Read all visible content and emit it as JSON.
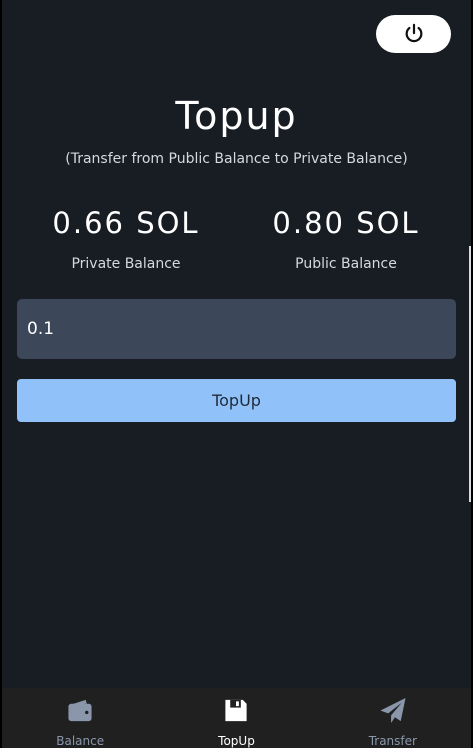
{
  "header": {
    "power_icon": "power-icon"
  },
  "main": {
    "title": "Topup",
    "subtitle": "(Transfer from Public Balance to Private Balance)",
    "private_balance": {
      "amount": "0.66 SOL",
      "label": "Private Balance"
    },
    "public_balance": {
      "amount": "0.80 SOL",
      "label": "Public Balance"
    },
    "amount_input": {
      "value": "0.1"
    },
    "topup_button_label": "TopUp"
  },
  "bottom_nav": {
    "items": [
      {
        "label": "Balance",
        "icon": "wallet-icon",
        "active": false
      },
      {
        "label": "TopUp",
        "icon": "floppy-disk-icon",
        "active": true
      },
      {
        "label": "Transfer",
        "icon": "paper-plane-icon",
        "active": false
      }
    ]
  },
  "colors": {
    "background": "#181c23",
    "input_bg": "#3c4759",
    "button_accent": "#90c2f9",
    "nav_bg": "#202020"
  }
}
